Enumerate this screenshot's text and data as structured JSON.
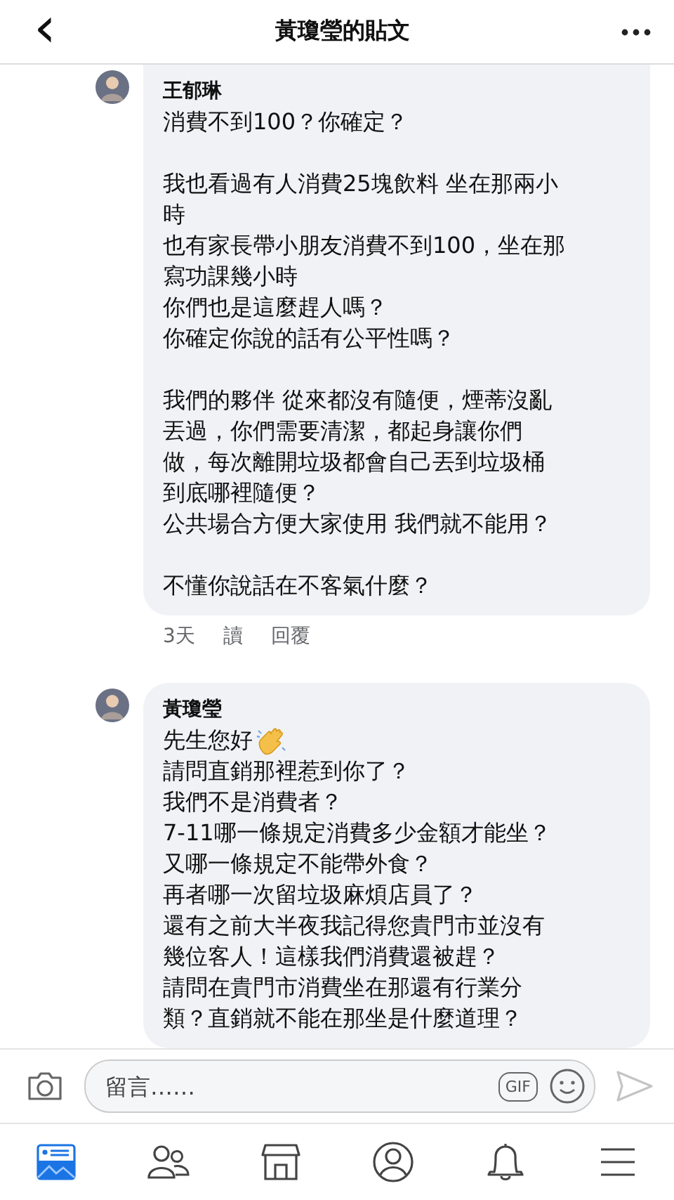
{
  "header": {
    "back": "‹",
    "title": "黃瓊瑩的貼文"
  },
  "comments": [
    {
      "author": "王郁琳",
      "paragraphs": [
        [
          "消費不到100？你確定？"
        ],
        [
          "我也看過有人消費25塊飲料 坐在那兩小",
          "時",
          "也有家長帶小朋友消費不到100，坐在那",
          "寫功課幾小時",
          "你們也是這麼趕人嗎？",
          "你確定你說的話有公平性嗎？"
        ],
        [
          "我們的夥伴 從來都沒有隨便，煙蒂沒亂",
          "丟過，你們需要清潔，都起身讓你們",
          "做，每次離開垃圾都會自己丟到垃圾桶",
          "到底哪裡隨便？",
          "公共場合方便大家使用 我們就不能用？"
        ],
        [
          "不懂你說話在不客氣什麼？"
        ]
      ],
      "wave": false,
      "meta": {
        "time": "3天",
        "read": "讀",
        "reply": "回覆"
      }
    },
    {
      "author": "黃瓊瑩",
      "paragraphs": [
        [
          "先生您好",
          "請問直銷那裡惹到你了？",
          "我們不是消費者？",
          "7-11哪一條規定消費多少金額才能坐？",
          "又哪一條規定不能帶外食？",
          "再者哪一次留垃圾麻煩店員了？",
          "還有之前大半夜我記得您貴門市並沒有",
          "幾位客人！這樣我們消費還被趕？",
          "請問在貴門市消費坐在那還有行業分",
          "類？直銷就不能在那坐是什麼道理？"
        ]
      ],
      "wave": true
    }
  ],
  "composer": {
    "placeholder": "留言……",
    "gif": "GIF"
  },
  "nav": [
    {
      "kind": "feed",
      "selected": true
    },
    {
      "kind": "friends",
      "selected": false
    },
    {
      "kind": "market",
      "selected": false
    },
    {
      "kind": "profile",
      "selected": false
    },
    {
      "kind": "bell",
      "selected": false
    },
    {
      "kind": "menu",
      "selected": false
    }
  ]
}
